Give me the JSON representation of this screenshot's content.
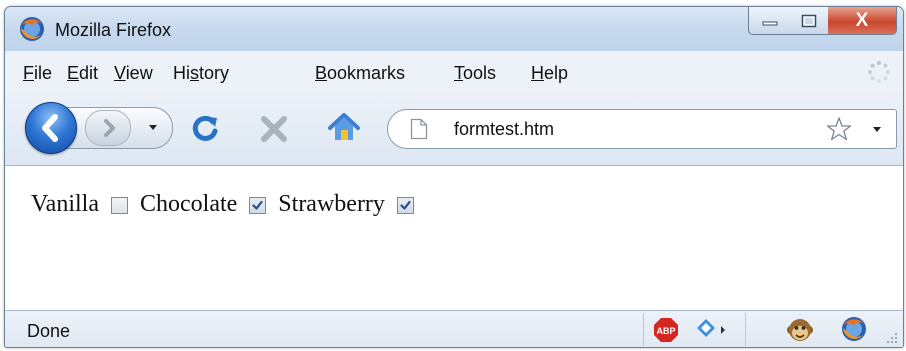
{
  "window": {
    "title": "Mozilla Firefox",
    "app_icon": "firefox-icon",
    "controls": {
      "minimize": "minimize-icon",
      "maximize": "maximize-icon",
      "close": "close-icon",
      "close_glyph": "X"
    }
  },
  "menu": {
    "items": [
      {
        "label": "File",
        "accesskey": "F"
      },
      {
        "label": "Edit",
        "accesskey": "E"
      },
      {
        "label": "View",
        "accesskey": "V"
      },
      {
        "label": "History",
        "accesskey": "s"
      },
      {
        "label": "Bookmarks",
        "accesskey": "B"
      },
      {
        "label": "Tools",
        "accesskey": "T"
      },
      {
        "label": "Help",
        "accesskey": "H"
      }
    ]
  },
  "navigation": {
    "back_icon": "back-arrow-icon",
    "forward_icon": "forward-arrow-icon",
    "reload_icon": "reload-icon",
    "stop_icon": "stop-icon",
    "home_icon": "home-icon"
  },
  "address_bar": {
    "value": "formtest.htm",
    "page_icon": "page-icon",
    "bookmark_icon": "star-icon"
  },
  "page": {
    "flavors": [
      {
        "label": "Vanilla",
        "checked": false
      },
      {
        "label": "Chocolate",
        "checked": true
      },
      {
        "label": "Strawberry",
        "checked": true
      }
    ]
  },
  "status_bar": {
    "text": "Done",
    "icons": [
      "adblock-plus-icon",
      "addon-arrow-icon",
      "monkey-icon",
      "firefox-icon"
    ],
    "abp_text": "ABP"
  },
  "colors": {
    "titlebar": "#c7d9ee",
    "chrome": "#edf2f8",
    "close_button": "#c8472d",
    "back_button": "#2f78d6",
    "reload": "#2a72c8",
    "stop": "#a9b3be",
    "home": "#3a7fd4"
  }
}
